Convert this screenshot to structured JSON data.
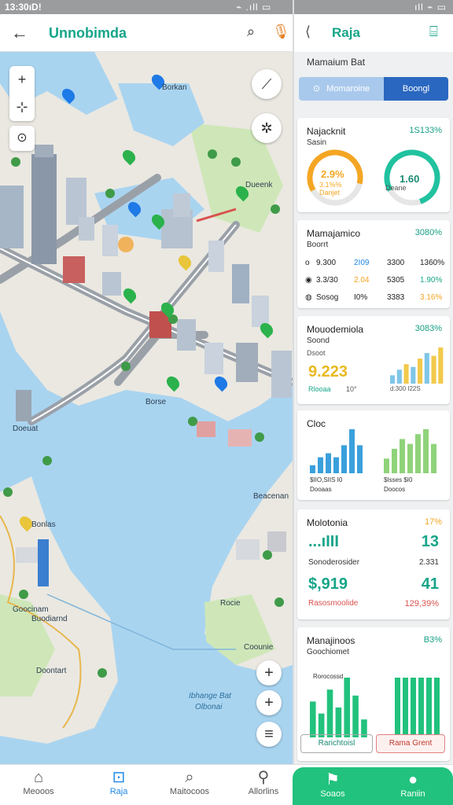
{
  "status_bar": {
    "time": "13:30ıD!",
    "signal": "⌁ .ıll ▭",
    "signal2": "ıll ⌁ ▭"
  },
  "left_header": {
    "title": "Unnobimda"
  },
  "map": {
    "labels": [
      "Borkan",
      "Dueenk",
      "Borse",
      "Doeuat",
      "Beacenan",
      "Bonlas",
      "Goocinam",
      "Buodiarnd",
      "Doontart",
      "Rocie",
      "Coounie",
      "Ibhange Bat",
      "Olbonai"
    ]
  },
  "right_header": {
    "title": "Raja"
  },
  "right_subtitle": "Mamaium Bat",
  "segment": {
    "left": "Momaroine",
    "right": "Boongl"
  },
  "card1": {
    "title": "Najacknit",
    "subtitle": "Sasin",
    "value": "1S133%",
    "gauge1": {
      "value": "2.9%",
      "label": "3.1%%\nDanjet",
      "fraction": 0.62,
      "color": "#f4a623"
    },
    "gauge2": {
      "value": "1.60",
      "label": "Deane",
      "fraction": 0.78,
      "color": "#21c2a0"
    }
  },
  "card2": {
    "title": "Mamajamico",
    "subtitle": "Boorrt",
    "value": "3080%",
    "rows": [
      {
        "icon": "o",
        "a": "9.300",
        "b": "2I09",
        "c": "3300",
        "d": "1360%"
      },
      {
        "icon": "◉",
        "a": "3.3/30",
        "b": "2.04",
        "c": "5305",
        "d": "1.90%"
      },
      {
        "icon": "◍",
        "a": "Sosog",
        "b": "I0%",
        "c": "3383",
        "d": "3.16%"
      }
    ]
  },
  "card3": {
    "title": "Mouodemiola",
    "subtitle": "Soond",
    "sub2": "Dsoot",
    "value": "3083%",
    "big": "9.223",
    "foot1": "Rlooaa",
    "foot2": "10°",
    "foot3": "d:300  I22S",
    "bars": [
      3,
      5,
      7,
      6,
      9,
      11,
      10,
      13
    ]
  },
  "card4": {
    "title": "Cloc",
    "foot1": "$IIO,SIIS   I0",
    "foot2": "Dooaas",
    "foot3": "$Isses   $I0",
    "foot4": "Doocos",
    "bars_a": [
      2,
      4,
      5,
      4,
      7,
      11,
      7
    ],
    "bars_b": [
      3,
      5,
      7,
      6,
      8,
      9,
      6
    ]
  },
  "card5": {
    "title": "Molotonia",
    "value": "17%",
    "v1": "...ıIII",
    "v2": "13",
    "label1": "Sonoderosider",
    "label2": "2.331",
    "v3": "$,919",
    "v4": "41",
    "label3": "Rasosmoolide",
    "label4": "129,39%"
  },
  "card6": {
    "title": "Manajinoos",
    "subtitle": "Goochiomet",
    "value": "B3%",
    "foot1": "Rorocossd",
    "btn_left": "Rarichtoisl",
    "btn_right": "Rama Grent",
    "bars_a": [
      6,
      4,
      8,
      5,
      10,
      7,
      3
    ],
    "bars_b": [
      10,
      10,
      10,
      10,
      10,
      10
    ]
  },
  "bottom_nav": [
    "Meooos",
    "Raja",
    "Maitocoos",
    "Allorlins",
    "Soaos",
    "Raniin"
  ],
  "colors": {
    "accent": "#17a589",
    "blue": "#2a67c0",
    "green": "#21c27d",
    "orange": "#f4a623"
  }
}
